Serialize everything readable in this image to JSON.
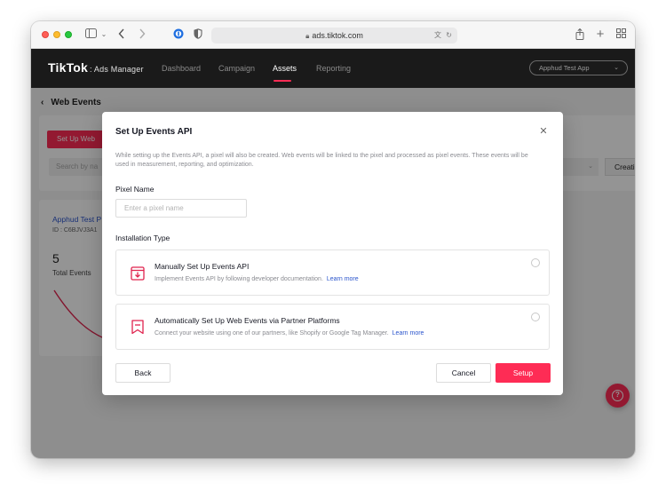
{
  "browser": {
    "url": "ads.tiktok.com",
    "icons": [
      "sidebar-icon",
      "chevron-down-icon",
      "back-icon",
      "forward-icon",
      "password-icon",
      "shield-icon",
      "lock-icon",
      "translate-icon",
      "reload-icon",
      "share-icon",
      "new-tab-icon",
      "tab-overview-icon"
    ]
  },
  "header": {
    "logo": "TikTok",
    "logo_suffix": ": Ads Manager",
    "nav": [
      "Dashboard",
      "Campaign",
      "Assets",
      "Reporting"
    ],
    "active_nav": "Assets",
    "account": "Apphud Test App"
  },
  "page": {
    "title": "Web Events",
    "setup_button": "Set Up Web",
    "search_placeholder": "Search by na",
    "create_button": "Creati",
    "pixel": {
      "name": "Apphud Test P",
      "id": "ID : C6BJVJ3A1",
      "total_value": "5",
      "total_label": "Total Events"
    }
  },
  "modal": {
    "title": "Set Up Events API",
    "description": "While setting up the Events API, a pixel will also be created. Web events will be linked to the pixel and processed as pixel events. These events will be used in measurement, reporting, and optimization.",
    "pixel_name_label": "Pixel Name",
    "pixel_name_placeholder": "Enter a pixel name",
    "pixel_name_value": "",
    "installation_label": "Installation Type",
    "options": [
      {
        "title": "Manually Set Up Events API",
        "description": "Implement Events API by following developer documentation.",
        "link": "Learn more",
        "selected": false
      },
      {
        "title": "Automatically Set Up Web Events via Partner Platforms",
        "description": "Connect your website using one of our partners, like Shopify or Google Tag Manager.",
        "link": "Learn more",
        "selected": false
      }
    ],
    "back_label": "Back",
    "cancel_label": "Cancel",
    "setup_label": "Setup"
  },
  "colors": {
    "brand": "#fe2c55",
    "link": "#2b55cc",
    "header_bg": "#1a1a1a"
  }
}
